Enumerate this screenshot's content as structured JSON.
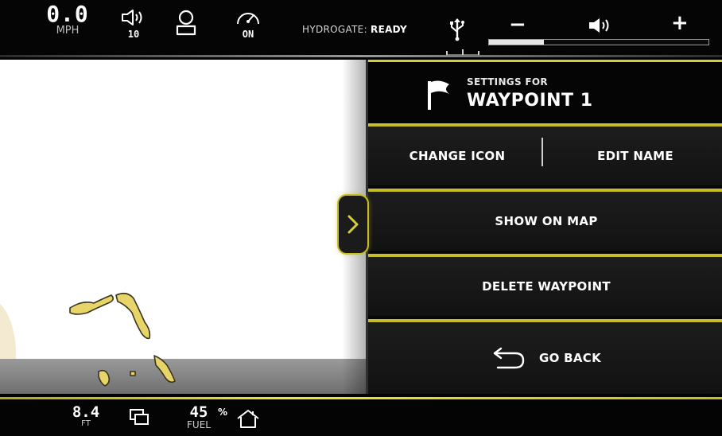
{
  "topbar": {
    "speed": {
      "value": "0.0",
      "unit": "MPH"
    },
    "alarm_volume": {
      "icon": "speaker-outline-icon",
      "value": "10"
    },
    "profile": {
      "icon": "user-icon"
    },
    "cruise": {
      "icon": "speedometer-icon",
      "value": "ON"
    },
    "hydrogate": {
      "label": "HYDROGATE:",
      "status": "READY"
    },
    "usb": {
      "icon": "usb-icon"
    },
    "volume": {
      "minus": "−",
      "plus": "+",
      "icon": "speaker-icon",
      "level": 0.25
    }
  },
  "panel": {
    "header": {
      "icon": "flag-icon",
      "subtitle": "SETTINGS FOR",
      "title": "WAYPOINT 1"
    },
    "change_icon": "CHANGE ICON",
    "edit_name": "EDIT NAME",
    "show_on_map": "SHOW ON MAP",
    "delete_waypoint": "DELETE WAYPOINT",
    "go_back": "GO BACK",
    "collapse_icon": "chevron-right-icon"
  },
  "bottombar": {
    "depth": {
      "value": "8.4",
      "unit": "FT"
    },
    "layers": {
      "icon": "layers-icon"
    },
    "fuel": {
      "value": "45",
      "unit": "FUEL",
      "percent": "%"
    },
    "home": {
      "icon": "home-icon"
    }
  },
  "colors": {
    "accent": "#c7bd2b",
    "land": "#e7d56a",
    "map_water": "#ffffff"
  }
}
